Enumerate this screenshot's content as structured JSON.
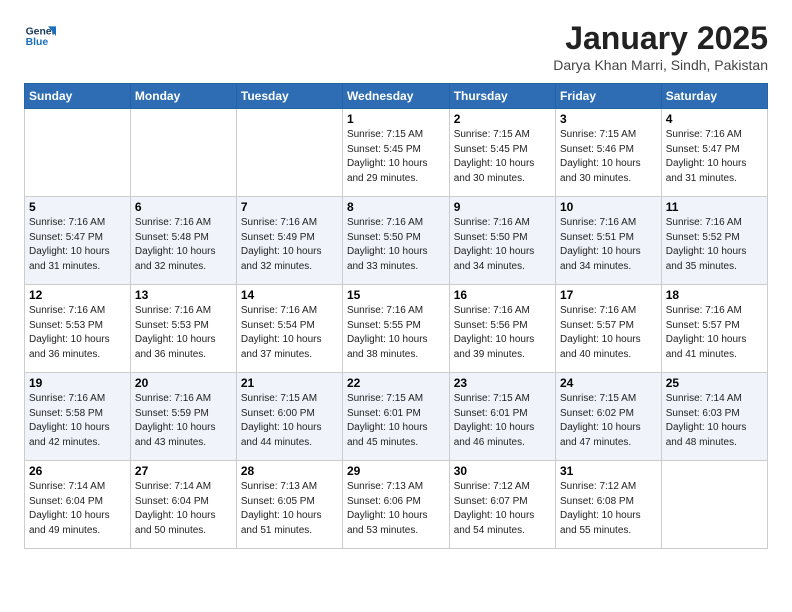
{
  "logo": {
    "line1": "General",
    "line2": "Blue"
  },
  "title": "January 2025",
  "location": "Darya Khan Marri, Sindh, Pakistan",
  "headers": [
    "Sunday",
    "Monday",
    "Tuesday",
    "Wednesday",
    "Thursday",
    "Friday",
    "Saturday"
  ],
  "weeks": [
    [
      {
        "day": "",
        "info": ""
      },
      {
        "day": "",
        "info": ""
      },
      {
        "day": "",
        "info": ""
      },
      {
        "day": "1",
        "info": "Sunrise: 7:15 AM\nSunset: 5:45 PM\nDaylight: 10 hours\nand 29 minutes."
      },
      {
        "day": "2",
        "info": "Sunrise: 7:15 AM\nSunset: 5:45 PM\nDaylight: 10 hours\nand 30 minutes."
      },
      {
        "day": "3",
        "info": "Sunrise: 7:15 AM\nSunset: 5:46 PM\nDaylight: 10 hours\nand 30 minutes."
      },
      {
        "day": "4",
        "info": "Sunrise: 7:16 AM\nSunset: 5:47 PM\nDaylight: 10 hours\nand 31 minutes."
      }
    ],
    [
      {
        "day": "5",
        "info": "Sunrise: 7:16 AM\nSunset: 5:47 PM\nDaylight: 10 hours\nand 31 minutes."
      },
      {
        "day": "6",
        "info": "Sunrise: 7:16 AM\nSunset: 5:48 PM\nDaylight: 10 hours\nand 32 minutes."
      },
      {
        "day": "7",
        "info": "Sunrise: 7:16 AM\nSunset: 5:49 PM\nDaylight: 10 hours\nand 32 minutes."
      },
      {
        "day": "8",
        "info": "Sunrise: 7:16 AM\nSunset: 5:50 PM\nDaylight: 10 hours\nand 33 minutes."
      },
      {
        "day": "9",
        "info": "Sunrise: 7:16 AM\nSunset: 5:50 PM\nDaylight: 10 hours\nand 34 minutes."
      },
      {
        "day": "10",
        "info": "Sunrise: 7:16 AM\nSunset: 5:51 PM\nDaylight: 10 hours\nand 34 minutes."
      },
      {
        "day": "11",
        "info": "Sunrise: 7:16 AM\nSunset: 5:52 PM\nDaylight: 10 hours\nand 35 minutes."
      }
    ],
    [
      {
        "day": "12",
        "info": "Sunrise: 7:16 AM\nSunset: 5:53 PM\nDaylight: 10 hours\nand 36 minutes."
      },
      {
        "day": "13",
        "info": "Sunrise: 7:16 AM\nSunset: 5:53 PM\nDaylight: 10 hours\nand 36 minutes."
      },
      {
        "day": "14",
        "info": "Sunrise: 7:16 AM\nSunset: 5:54 PM\nDaylight: 10 hours\nand 37 minutes."
      },
      {
        "day": "15",
        "info": "Sunrise: 7:16 AM\nSunset: 5:55 PM\nDaylight: 10 hours\nand 38 minutes."
      },
      {
        "day": "16",
        "info": "Sunrise: 7:16 AM\nSunset: 5:56 PM\nDaylight: 10 hours\nand 39 minutes."
      },
      {
        "day": "17",
        "info": "Sunrise: 7:16 AM\nSunset: 5:57 PM\nDaylight: 10 hours\nand 40 minutes."
      },
      {
        "day": "18",
        "info": "Sunrise: 7:16 AM\nSunset: 5:57 PM\nDaylight: 10 hours\nand 41 minutes."
      }
    ],
    [
      {
        "day": "19",
        "info": "Sunrise: 7:16 AM\nSunset: 5:58 PM\nDaylight: 10 hours\nand 42 minutes."
      },
      {
        "day": "20",
        "info": "Sunrise: 7:16 AM\nSunset: 5:59 PM\nDaylight: 10 hours\nand 43 minutes."
      },
      {
        "day": "21",
        "info": "Sunrise: 7:15 AM\nSunset: 6:00 PM\nDaylight: 10 hours\nand 44 minutes."
      },
      {
        "day": "22",
        "info": "Sunrise: 7:15 AM\nSunset: 6:01 PM\nDaylight: 10 hours\nand 45 minutes."
      },
      {
        "day": "23",
        "info": "Sunrise: 7:15 AM\nSunset: 6:01 PM\nDaylight: 10 hours\nand 46 minutes."
      },
      {
        "day": "24",
        "info": "Sunrise: 7:15 AM\nSunset: 6:02 PM\nDaylight: 10 hours\nand 47 minutes."
      },
      {
        "day": "25",
        "info": "Sunrise: 7:14 AM\nSunset: 6:03 PM\nDaylight: 10 hours\nand 48 minutes."
      }
    ],
    [
      {
        "day": "26",
        "info": "Sunrise: 7:14 AM\nSunset: 6:04 PM\nDaylight: 10 hours\nand 49 minutes."
      },
      {
        "day": "27",
        "info": "Sunrise: 7:14 AM\nSunset: 6:04 PM\nDaylight: 10 hours\nand 50 minutes."
      },
      {
        "day": "28",
        "info": "Sunrise: 7:13 AM\nSunset: 6:05 PM\nDaylight: 10 hours\nand 51 minutes."
      },
      {
        "day": "29",
        "info": "Sunrise: 7:13 AM\nSunset: 6:06 PM\nDaylight: 10 hours\nand 53 minutes."
      },
      {
        "day": "30",
        "info": "Sunrise: 7:12 AM\nSunset: 6:07 PM\nDaylight: 10 hours\nand 54 minutes."
      },
      {
        "day": "31",
        "info": "Sunrise: 7:12 AM\nSunset: 6:08 PM\nDaylight: 10 hours\nand 55 minutes."
      },
      {
        "day": "",
        "info": ""
      }
    ]
  ]
}
